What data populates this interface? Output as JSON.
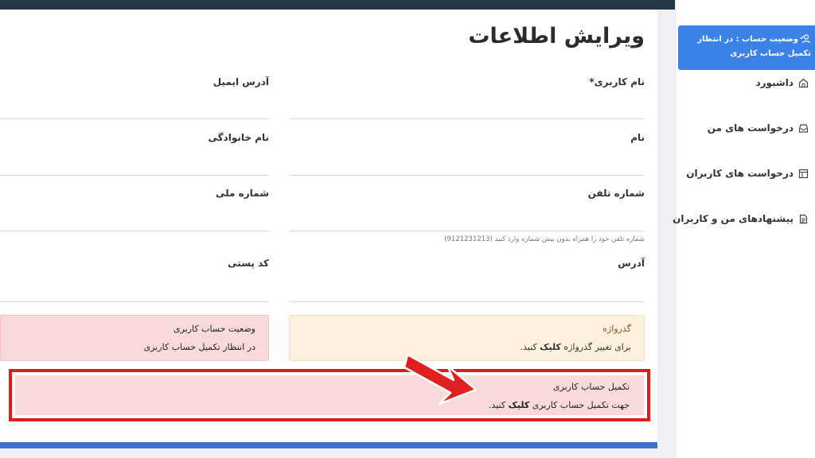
{
  "page": {
    "title": "ویرایش اطلاعات"
  },
  "form": {
    "username_label": "نام کاربری*",
    "email_label": "آدرس ایمیل",
    "first_name_label": "نام",
    "last_name_label": "نام خانوادگی",
    "phone_label": "شماره تلفن",
    "national_id_label": "شماره ملی",
    "phone_hint": "شماره تلفن خود را همراه بدون پیش شماره وارد کنید (9121231213)",
    "address_label": "آدرس",
    "postal_code_label": "کد پستی"
  },
  "password_box": {
    "title": "گذرواژه",
    "text_before": "برای تغییر گذرواژه ",
    "text_bold": "کلیک",
    "text_after": " کنید."
  },
  "status_box": {
    "title": "وضعیت حساب کاربری",
    "value": "در انتظار تکمیل حساب کاربری"
  },
  "complete_box": {
    "title": "تکمیل حساب کاربری",
    "text_before": "جهت تکمیل حساب کاربری ",
    "text_bold": "کلیک",
    "text_after": " کنید."
  },
  "sidebar": {
    "account_status_line1": "وضعیت حساب : در انتظار",
    "account_status_line2": "تکمیل حساب کاربری",
    "items": [
      {
        "label": "داشبورد",
        "icon": "home-icon"
      },
      {
        "label": "درخواست های من",
        "icon": "inbox-icon"
      },
      {
        "label": "درخواست های کاربران",
        "icon": "layout-icon"
      },
      {
        "label": "پیشنهادهای من و کاربران",
        "icon": "document-icon"
      }
    ]
  },
  "colors": {
    "accent": "#3b82e6",
    "highlight_border": "#e21a1a",
    "arrow": "#e02020",
    "alert_bg": "#f8dada",
    "warning_bg": "#fdf0dc"
  }
}
